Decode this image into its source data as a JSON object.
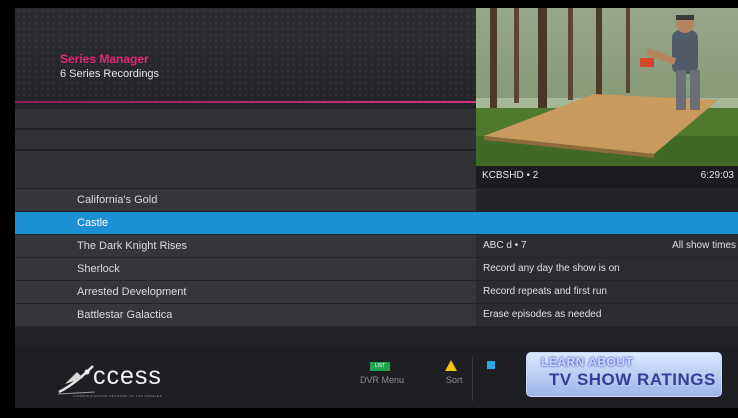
{
  "header": {
    "title": "Series Manager",
    "subtitle": "6 Series Recordings"
  },
  "player": {
    "channel": "KCBSHD • 2",
    "time": "6:29:03",
    "recording_indicator_color": "#e53030"
  },
  "series": [
    {
      "label": "California's Gold",
      "selected": false
    },
    {
      "label": "Castle",
      "selected": true
    },
    {
      "label": "The Dark Knight Rises",
      "selected": false
    },
    {
      "label": "Sherlock",
      "selected": false
    },
    {
      "label": "Arrested Development",
      "selected": false
    },
    {
      "label": "Battlestar Galactica",
      "selected": false
    }
  ],
  "details": {
    "channel": "ABC d • 7",
    "show_times": "All show times",
    "record_rule": "Record any day the show is on",
    "episodes_rule": "Record repeats and first run",
    "erase_rule": "Erase episodes as needed"
  },
  "footer": {
    "logo_text": "ccess",
    "logo_tagline": "COMMUNICATIONS NETWORK OF LOS ANGELES",
    "list_button": "LIST",
    "dvr_menu_label": "DVR Menu",
    "sort_label": "Sort",
    "ad_line1": "LEARN ABOUT",
    "ad_line2": "TV SHOW RATINGS"
  },
  "colors": {
    "accent_pink": "#e0297a",
    "selection_blue": "#1d8fd5",
    "list_button_green": "#1fa24d",
    "sort_button_yellow": "#f2c40f",
    "option_button_blue": "#2aa9e8"
  }
}
